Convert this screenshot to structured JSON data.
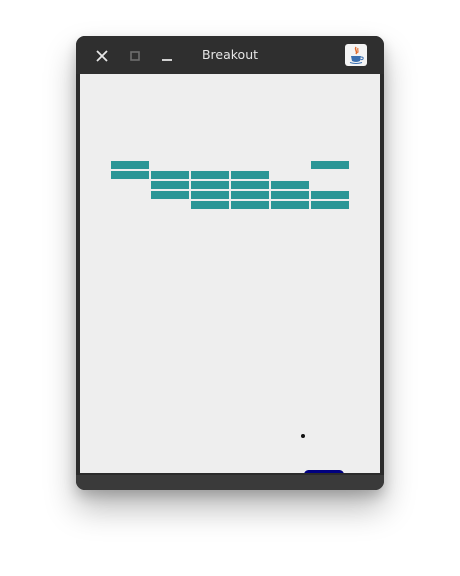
{
  "window": {
    "title": "Breakout",
    "icons": {
      "close": "close-icon",
      "maximize": "maximize-icon",
      "minimize": "minimize-icon",
      "app": "java-icon"
    }
  },
  "game": {
    "brick_color": "#2b9696",
    "ball_color": "#111111",
    "paddle_color": "#000080",
    "canvas_color": "#eeeeee"
  }
}
